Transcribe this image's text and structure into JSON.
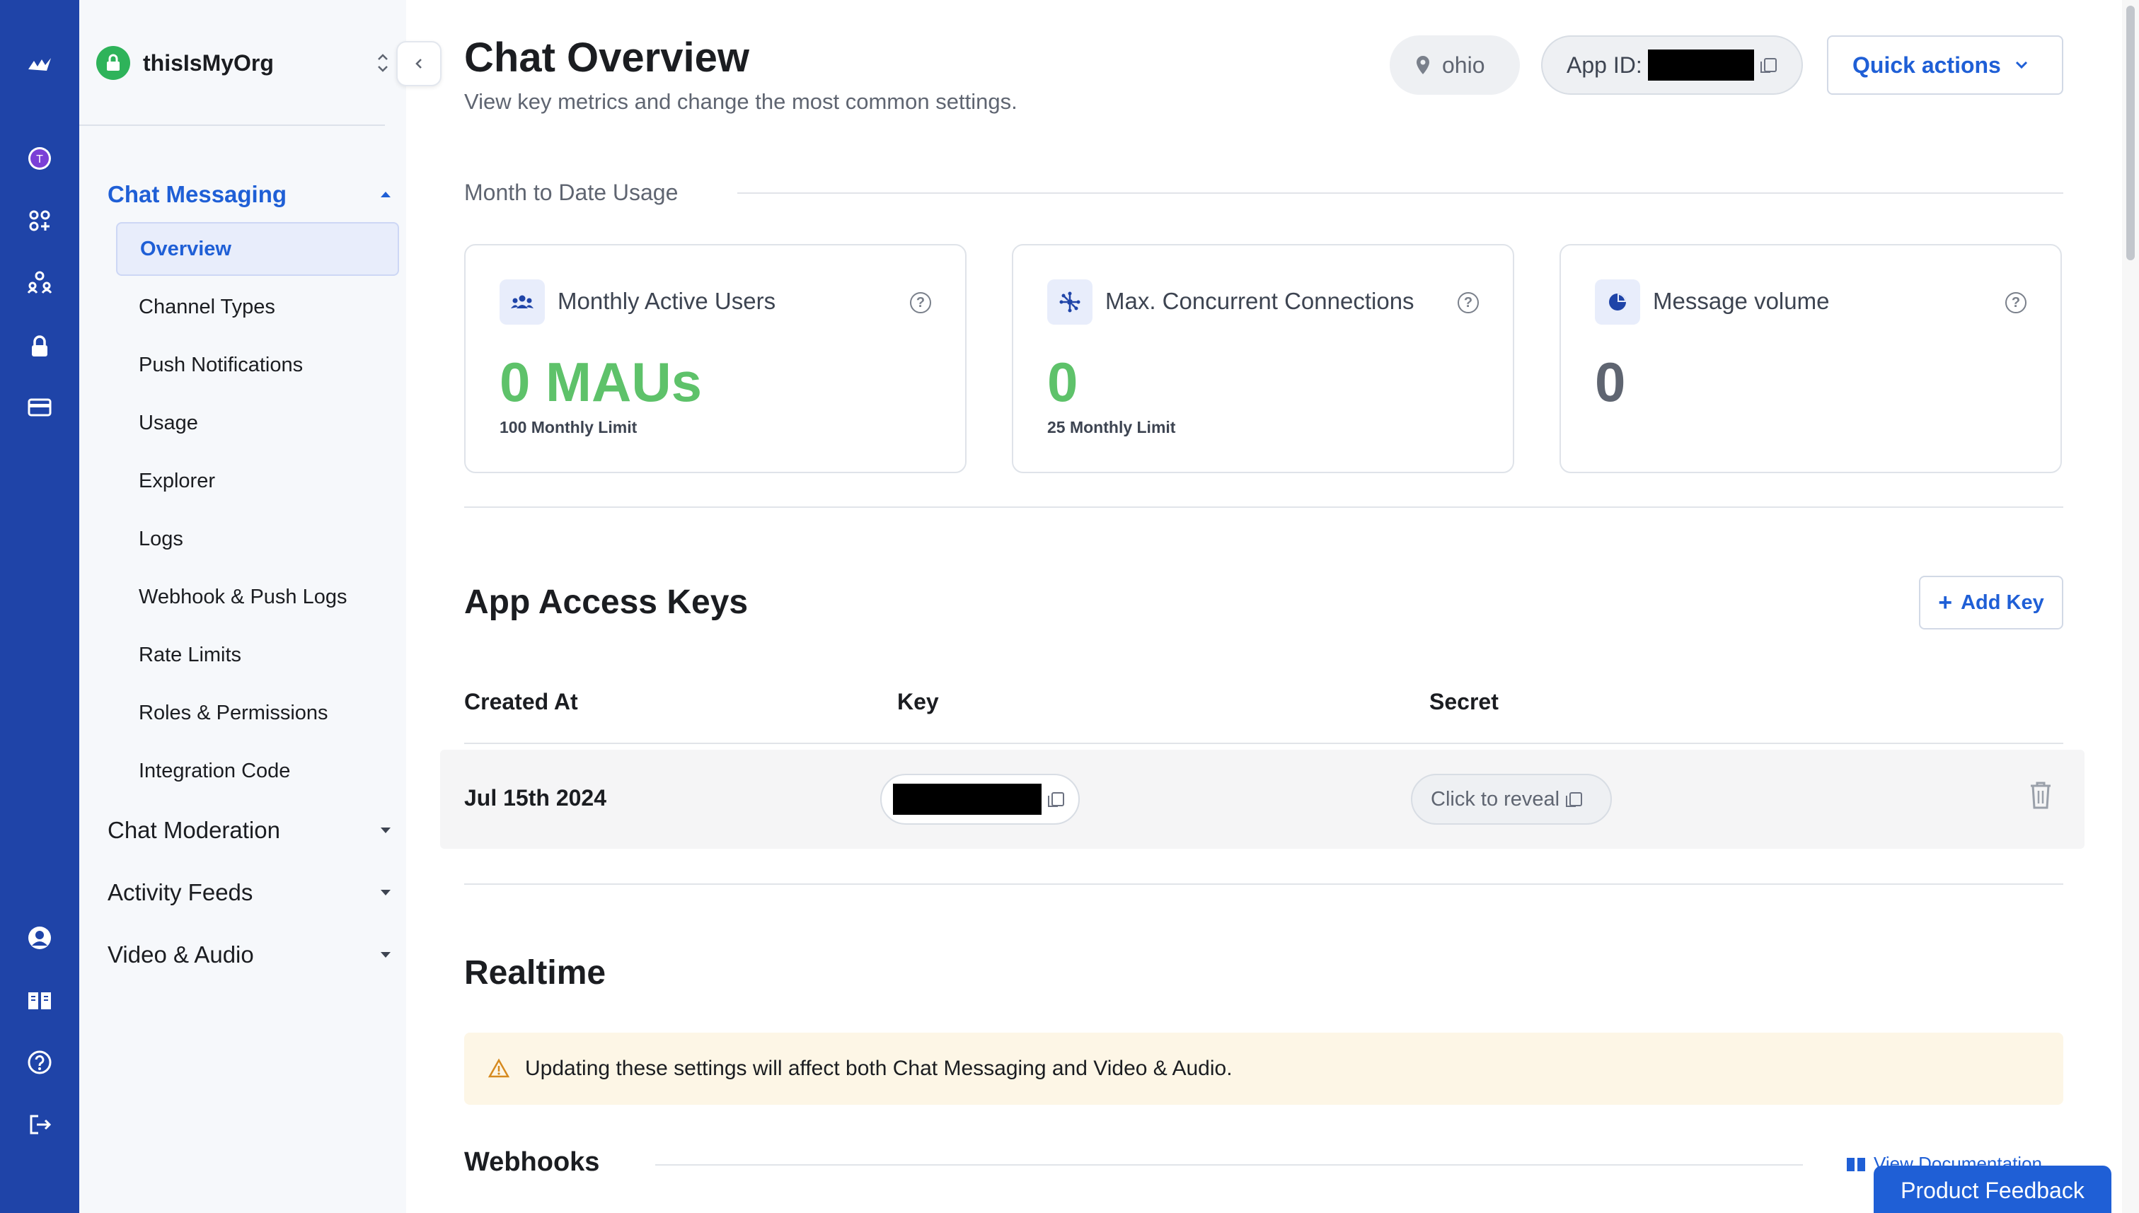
{
  "org": {
    "name": "thisIsMyOrg"
  },
  "rail": {
    "user_initial": "T"
  },
  "sidebar": {
    "sections": [
      {
        "label": "Chat Messaging",
        "expanded": true
      },
      {
        "label": "Chat Moderation",
        "expanded": false
      },
      {
        "label": "Activity Feeds",
        "expanded": false
      },
      {
        "label": "Video & Audio",
        "expanded": false
      }
    ],
    "items": [
      {
        "label": "Overview",
        "active": true
      },
      {
        "label": "Channel Types"
      },
      {
        "label": "Push Notifications"
      },
      {
        "label": "Usage"
      },
      {
        "label": "Explorer"
      },
      {
        "label": "Logs"
      },
      {
        "label": "Webhook & Push Logs"
      },
      {
        "label": "Rate Limits"
      },
      {
        "label": "Roles & Permissions"
      },
      {
        "label": "Integration Code"
      }
    ]
  },
  "header": {
    "title": "Chat Overview",
    "subtitle": "View key metrics and change the most common settings.",
    "region": "ohio",
    "app_id_label": "App ID:",
    "quick_actions": "Quick actions"
  },
  "usage": {
    "section_label": "Month to Date Usage",
    "cards": [
      {
        "title": "Monthly Active Users",
        "value": "0 MAUs",
        "limit": "100 Monthly Limit"
      },
      {
        "title": "Max. Concurrent Connections",
        "value": "0",
        "limit": "25 Monthly Limit"
      },
      {
        "title": "Message volume",
        "value": "0"
      }
    ]
  },
  "keys": {
    "title": "App Access Keys",
    "add_label": "Add Key",
    "columns": [
      "Created At",
      "Key",
      "Secret"
    ],
    "rows": [
      {
        "created_at": "Jul 15th 2024",
        "secret": "Click to reveal"
      }
    ]
  },
  "realtime": {
    "title": "Realtime",
    "warning": "Updating these settings will affect both Chat Messaging and Video & Audio."
  },
  "webhooks": {
    "title": "Webhooks",
    "doc_link": "View Documentation"
  },
  "feedback": {
    "label": "Product Feedback"
  },
  "colors": {
    "rail": "#1f44a8",
    "accent": "#1f5fd6",
    "success": "#5ec26a",
    "warning_bg": "#fdf6e6"
  }
}
